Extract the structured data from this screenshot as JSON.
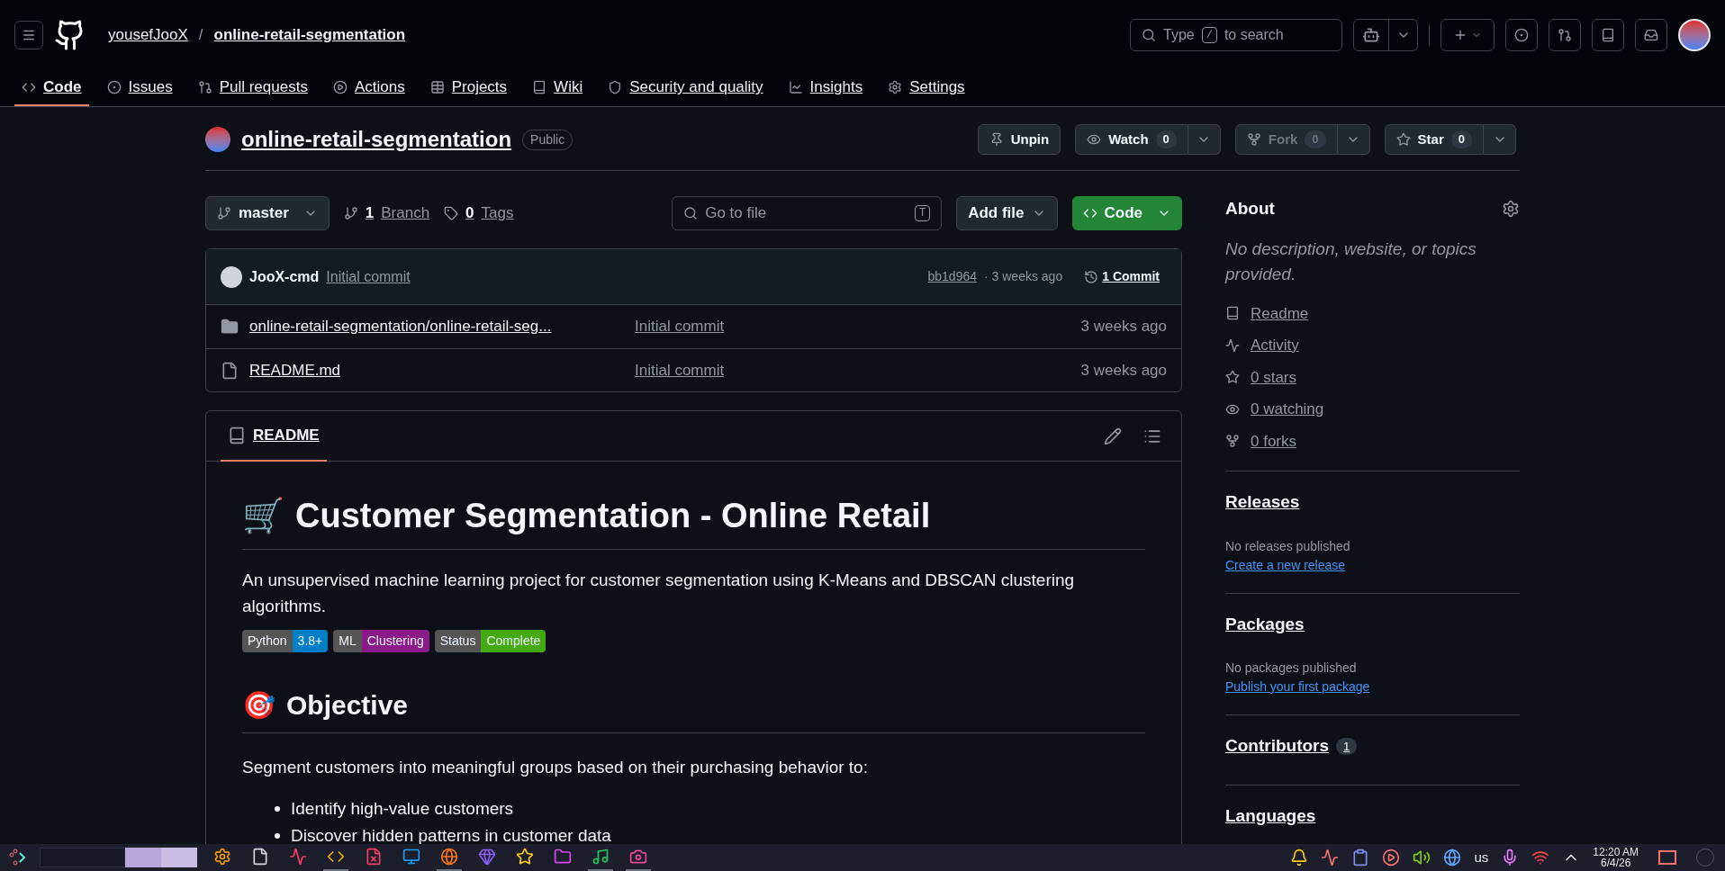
{
  "header": {
    "owner": "yousefJooX",
    "separator": "/",
    "repo": "online-retail-segmentation",
    "search": {
      "prefix": "Type",
      "key": "/",
      "suffix": "to search"
    }
  },
  "tabs": [
    {
      "label": "Code",
      "selected": true
    },
    {
      "label": "Issues",
      "selected": false
    },
    {
      "label": "Pull requests",
      "selected": false
    },
    {
      "label": "Actions",
      "selected": false
    },
    {
      "label": "Projects",
      "selected": false
    },
    {
      "label": "Wiki",
      "selected": false
    },
    {
      "label": "Security and quality",
      "selected": false
    },
    {
      "label": "Insights",
      "selected": false
    },
    {
      "label": "Settings",
      "selected": false
    }
  ],
  "repo_title": {
    "name": "online-retail-segmentation",
    "visibility": "Public",
    "actions": [
      {
        "kind": "plain",
        "label": "Unpin",
        "disabled": false
      },
      {
        "kind": "split",
        "label": "Watch",
        "count": "0",
        "disabled": false
      },
      {
        "kind": "split",
        "label": "Fork",
        "count": "0",
        "disabled": true
      },
      {
        "kind": "split",
        "label": "Star",
        "count": "0",
        "disabled": false
      }
    ]
  },
  "toolbar": {
    "branch": "master",
    "branches": {
      "count": "1",
      "label": "Branch"
    },
    "tags": {
      "count": "0",
      "label": "Tags"
    },
    "go_to_file": {
      "placeholder": "Go to file",
      "key": "T"
    },
    "add_file": "Add file",
    "code": "Code"
  },
  "commit": {
    "author": "JooX-cmd",
    "message": "Initial commit",
    "hash": "bb1d964",
    "time": "· 3 weeks ago",
    "commits": "1 Commit"
  },
  "files": [
    {
      "kind": "folder",
      "name": "online-retail-segmentation/online-retail-seg...",
      "message": "Initial commit",
      "time": "3 weeks ago"
    },
    {
      "kind": "file",
      "name": "README.md",
      "message": "Initial commit",
      "time": "3 weeks ago"
    }
  ],
  "readme": {
    "tab": "README",
    "title_emoji": "🛒",
    "title": "Customer Segmentation - Online Retail",
    "intro": "An unsupervised machine learning project for customer segmentation using K-Means and DBSCAN clustering algorithms.",
    "badges": [
      {
        "label": "Python",
        "value": "3.8+",
        "color": "#007ec6"
      },
      {
        "label": "ML",
        "value": "Clustering",
        "color": "#8a1a8a"
      },
      {
        "label": "Status",
        "value": "Complete",
        "color": "#44aa11"
      }
    ],
    "section_emoji": "🎯",
    "section": "Objective",
    "section_text": "Segment customers into meaningful groups based on their purchasing behavior to:",
    "bullets": [
      "Identify high-value customers",
      "Discover hidden patterns in customer data"
    ]
  },
  "about": {
    "title": "About",
    "description": "No description, website, or topics provided.",
    "links": [
      "Readme",
      "Activity",
      "0 stars",
      "0 watching",
      "0 forks"
    ]
  },
  "sidebar_sections": [
    {
      "title": "Releases",
      "note": "No releases published",
      "link": "Create a new release"
    },
    {
      "title": "Packages",
      "note": "No packages published",
      "link": "Publish your first package"
    },
    {
      "title": "Contributors",
      "count": "1"
    },
    {
      "title": "Languages"
    }
  ],
  "taskbar": {
    "apps": [
      {
        "active": false
      },
      {
        "active": false
      },
      {
        "active": false
      },
      {
        "active": true
      },
      {
        "active": false
      },
      {
        "active": false
      },
      {
        "active": true
      },
      {
        "active": false
      },
      {
        "active": false
      },
      {
        "active": false
      },
      {
        "active": true
      },
      {
        "active": true
      }
    ],
    "layout": "us",
    "time": "12:20 AM",
    "date": "6/4/26"
  }
}
